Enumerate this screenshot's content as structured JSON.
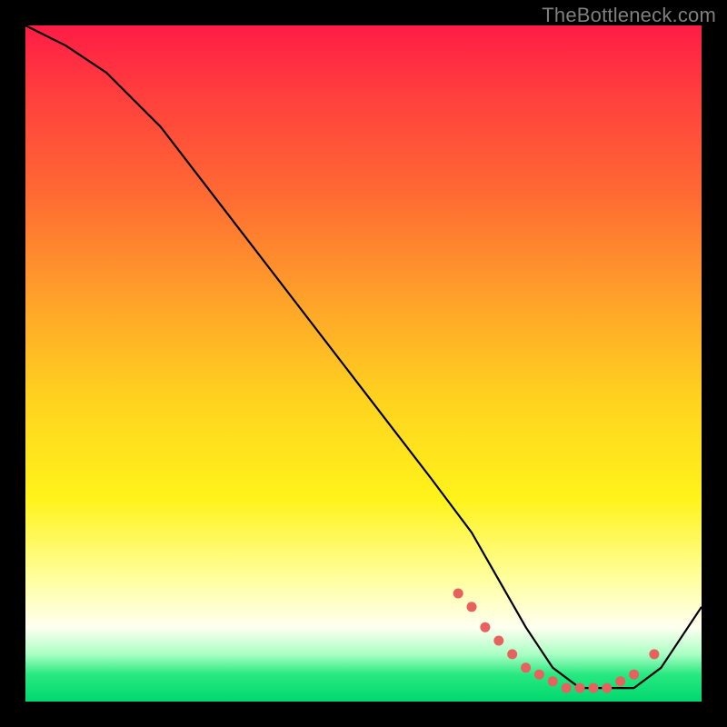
{
  "watermark": "TheBottleneck.com",
  "colors": {
    "background": "#000000",
    "curve": "#000000",
    "markers": "#e7625f",
    "gradient_top": "#ff1c46",
    "gradient_mid": "#ffd21f",
    "gradient_bottom": "#00d86f"
  },
  "chart_data": {
    "type": "line",
    "title": "",
    "xlabel": "",
    "ylabel": "",
    "xlim": [
      0,
      100
    ],
    "ylim": [
      0,
      100
    ],
    "grid": false,
    "legend": null,
    "series": [
      {
        "name": "bottleneck-curve",
        "x": [
          0,
          6,
          12,
          20,
          30,
          40,
          50,
          60,
          66,
          70,
          74,
          78,
          82,
          86,
          90,
          94,
          100
        ],
        "y": [
          100,
          97,
          93,
          85,
          72,
          59,
          46,
          33,
          25,
          18,
          11,
          5,
          2,
          2,
          2,
          5,
          14
        ]
      }
    ],
    "markers": {
      "name": "highlight-points",
      "x": [
        64,
        66,
        68,
        70,
        72,
        74,
        76,
        78,
        80,
        82,
        84,
        86,
        88,
        90,
        93
      ],
      "y": [
        16,
        14,
        11,
        9,
        7,
        5,
        4,
        3,
        2,
        2,
        2,
        2,
        3,
        4,
        7
      ]
    }
  }
}
